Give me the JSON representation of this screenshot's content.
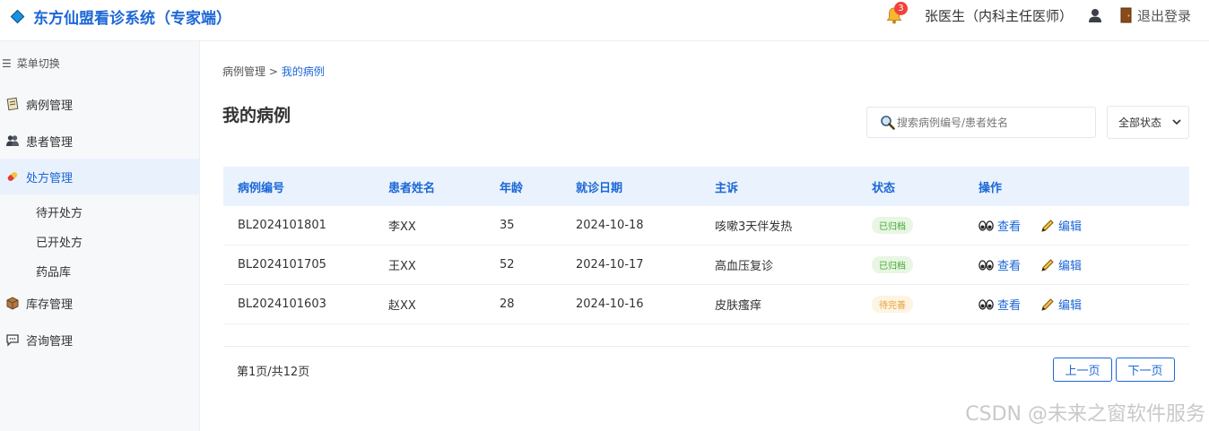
{
  "header": {
    "title": "东方仙盟看诊系统（专家端）",
    "notification_count": "3",
    "doctor": "张医生（内科主任医师）",
    "logout_label": "退出登录"
  },
  "sidebar": {
    "toggle_label": "菜单切换",
    "items": [
      {
        "label": "病例管理",
        "icon": "case-icon"
      },
      {
        "label": "患者管理",
        "icon": "patients-icon"
      },
      {
        "label": "处方管理",
        "icon": "prescription-icon",
        "active": true
      },
      {
        "label": "库存管理",
        "icon": "inventory-icon"
      },
      {
        "label": "咨询管理",
        "icon": "chat-icon"
      }
    ],
    "sub_items": [
      "待开处方",
      "已开处方",
      "药品库"
    ]
  },
  "breadcrumb": {
    "root": "病例管理",
    "separator": ">",
    "current": "我的病例"
  },
  "page_title": "我的病例",
  "search": {
    "placeholder": "搜索病例编号/患者姓名",
    "value": ""
  },
  "status_filter": {
    "selected": "全部状态"
  },
  "table": {
    "headers": [
      "病例编号",
      "患者姓名",
      "年龄",
      "就诊日期",
      "主诉",
      "状态",
      "操作"
    ],
    "rows": [
      {
        "id": "BL2024101801",
        "name": "李XX",
        "age": "35",
        "date": "2024-10-18",
        "complaint": "咳嗽3天伴发热",
        "status": "已归档",
        "status_type": "archived"
      },
      {
        "id": "BL2024101705",
        "name": "王XX",
        "age": "52",
        "date": "2024-10-17",
        "complaint": "高血压复诊",
        "status": "已归档",
        "status_type": "archived"
      },
      {
        "id": "BL2024101603",
        "name": "赵XX",
        "age": "28",
        "date": "2024-10-16",
        "complaint": "皮肤瘙痒",
        "status": "待完善",
        "status_type": "pending"
      }
    ],
    "actions": {
      "view": "查看",
      "edit": "编辑"
    }
  },
  "pagination": {
    "info": "第1页/共12页",
    "prev": "上一页",
    "next": "下一页"
  },
  "watermark": "CSDN @未来之窗软件服务",
  "colors": {
    "accent": "#1c67d6",
    "header_bg": "#e9f2fd",
    "archived": "#44a832",
    "pending": "#e6a23c"
  }
}
